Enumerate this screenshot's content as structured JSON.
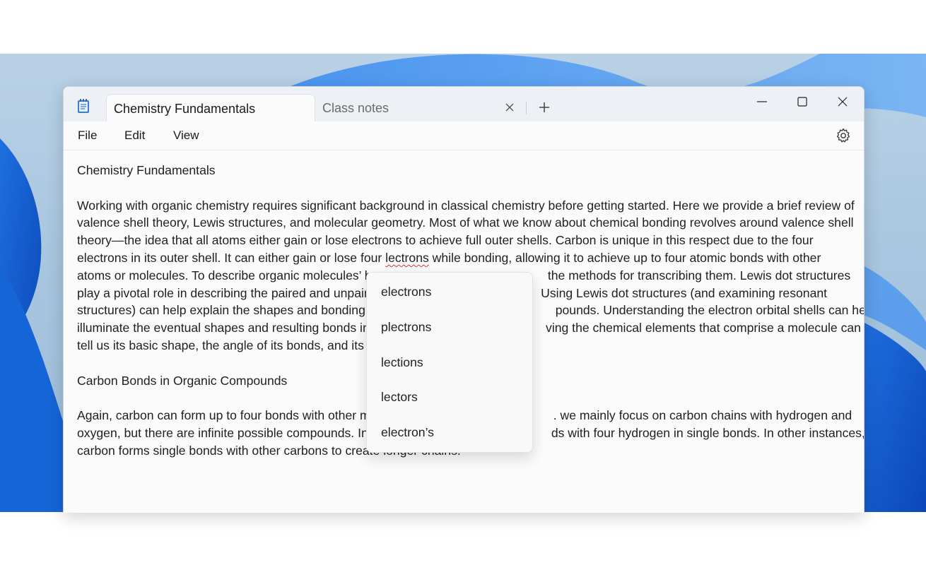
{
  "window": {
    "tabs": [
      {
        "label": "Chemistry Fundamentals",
        "active": true
      },
      {
        "label": "Class notes",
        "active": false
      }
    ],
    "icons": {
      "app": "notepad-icon",
      "tab_close": "close-icon",
      "new_tab": "plus-icon",
      "minimize": "minimize-icon",
      "maximize": "maximize-icon",
      "close": "close-icon",
      "settings": "gear-icon"
    }
  },
  "menu": {
    "file": "File",
    "edit": "Edit",
    "view": "View"
  },
  "document": {
    "heading1": "Chemistry Fundamentals",
    "para1_lines": [
      "Working with organic chemistry requires significant background in classical chemistry before getting started. Here we provide a brief review of",
      "valence shell theory, Lewis structures, and molecular geometry. Most of what we know about chemical bonding revolves around valence shell",
      "theory—the idea that all atoms either gain or lose electrons to achieve full outer shells. Carbon is unique in this respect due to the four"
    ],
    "para1_line4_before": "electrons in its outer shell. It can either gain or lose four ",
    "para1_line4_misspelled": "lectrons",
    "para1_line4_after": " while bonding, allowing it to achieve up to four atomic bonds with other",
    "para1_lines_rest": [
      "atoms or molecules. To describe organic molecules’ bo                                                 the methods for transcribing them. Lewis dot structures",
      "play a pivotal role in describing the paired and unpair                                                  Using Lewis dot structures (and examining resonant",
      "structures) can help explain the shapes and bonding p                                                    pounds. Understanding the electron orbital shells can help",
      "illuminate the eventual shapes and resulting bonds in                                                   ving the chemical elements that comprise a molecule can",
      "tell us its basic shape, the angle of its bonds, and its u"
    ],
    "heading2": "Carbon Bonds in Organic Compounds",
    "para2_lines": [
      "Again, carbon can form up to four bonds with other m                                                     . we mainly focus on carbon chains with hydrogen and",
      "oxygen, but there are infinite possible compounds. In                                                     ds with four hydrogen in single bonds. In other instances,",
      "carbon forms single bonds with other carbons to create longer chains."
    ]
  },
  "spell_suggestions": [
    "electrons",
    "plectrons",
    "lections",
    "lectors",
    "electron’s"
  ],
  "colors": {
    "accent_underline": "#d13438",
    "titlebar": "#edf0f4",
    "editor_bg": "#fbfbfc"
  }
}
